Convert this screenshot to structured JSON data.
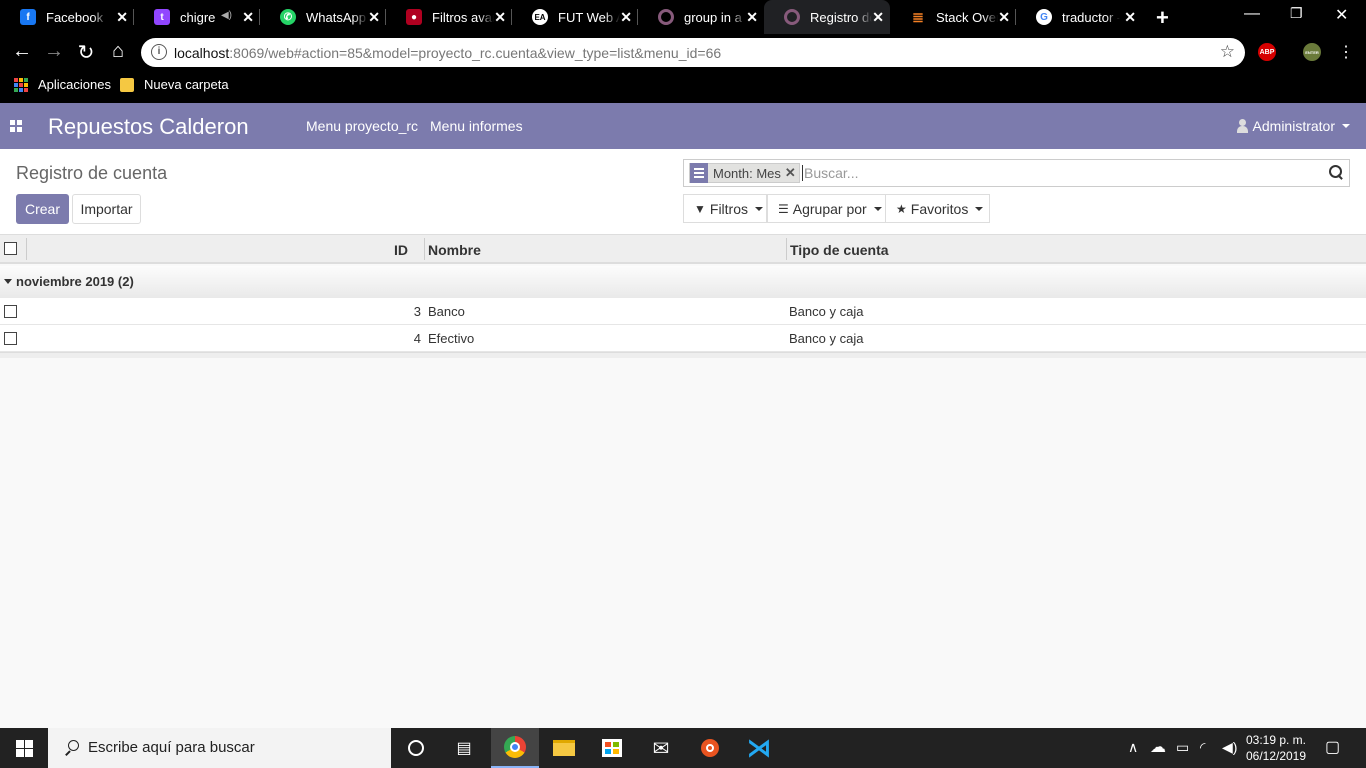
{
  "browser": {
    "tabs": [
      {
        "title": "Facebook",
        "icon": "facebook-icon",
        "color": "#1877f2"
      },
      {
        "title": "chigre",
        "icon": "twitch-icon",
        "color": "#9146ff"
      },
      {
        "title": "WhatsApp",
        "icon": "whatsapp-icon",
        "color": "#25d366"
      },
      {
        "title": "Filtros avanzados",
        "icon": "filtros-icon",
        "color": "#b00020"
      },
      {
        "title": "FUT Web App",
        "icon": "ea-icon",
        "color": "#ffffff"
      },
      {
        "title": "group in a view",
        "icon": "odoo-icon",
        "color": "#875a7b"
      },
      {
        "title": "Registro de cuenta",
        "icon": "odoo-icon",
        "color": "#875a7b"
      },
      {
        "title": "Stack Overflow",
        "icon": "stackoverflow-icon",
        "color": "#f48024"
      },
      {
        "title": "traductor - Buscar con Google",
        "icon": "google-icon",
        "color": "#4285f4"
      }
    ],
    "url_host": "localhost",
    "url_rest": ":8069/web#action=85&model=proyecto_rc.cuenta&view_type=list&menu_id=66",
    "extensions": [
      {
        "label": "ABP",
        "color": "#d60000"
      },
      {
        "label": "ENTER",
        "color": "#6a7a3a"
      }
    ],
    "bookmarks": [
      "Aplicaciones",
      "Nueva carpeta"
    ]
  },
  "odoo": {
    "brand": "Repuestos Calderon",
    "menus": [
      "Menu proyecto_rc",
      "Menu informes"
    ],
    "user": "Administrator",
    "accent": "#7c7bad"
  },
  "control": {
    "title": "Registro de cuenta",
    "create_label": "Crear",
    "import_label": "Importar",
    "facet_value": "Month: Mes",
    "search_placeholder": "Buscar...",
    "filters_label": "Filtros",
    "groupby_label": "Agrupar por",
    "favorites_label": "Favoritos"
  },
  "table": {
    "columns": [
      "ID",
      "Nombre",
      "Tipo de cuenta"
    ],
    "group_label": "noviembre 2019 (2)",
    "rows": [
      {
        "id": "3",
        "nombre": "Banco",
        "tipo": "Banco y caja"
      },
      {
        "id": "4",
        "nombre": "Efectivo",
        "tipo": "Banco y caja"
      }
    ]
  },
  "taskbar": {
    "search_text": "Escribe aquí para buscar",
    "time": "03:19 p. m.",
    "date": "06/12/2019"
  }
}
